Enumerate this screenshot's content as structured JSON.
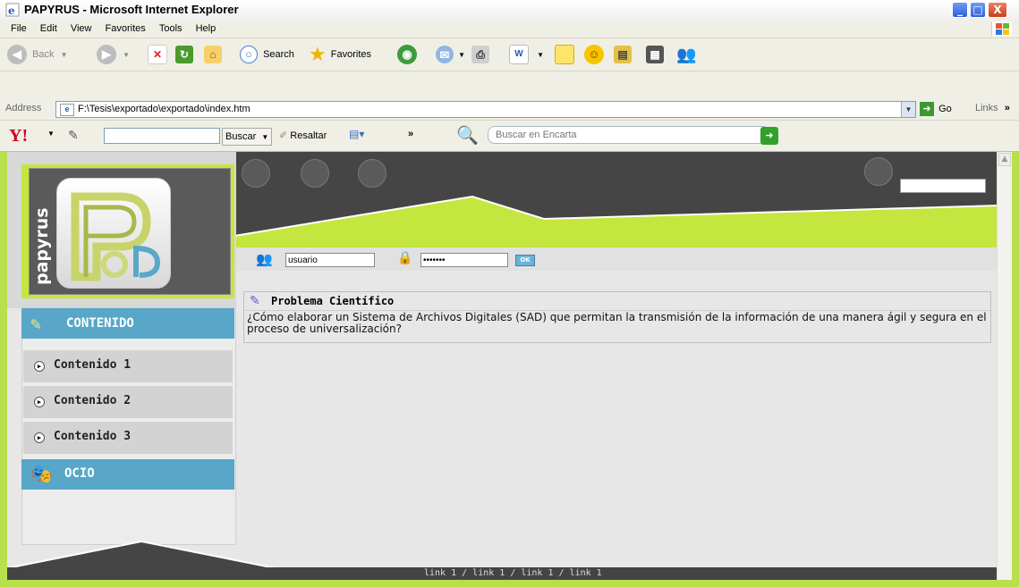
{
  "window": {
    "title": "PAPYRUS - Microsoft Internet Explorer",
    "minimize": "_",
    "maximize": "□",
    "close": "X"
  },
  "menu": [
    "File",
    "Edit",
    "View",
    "Favorites",
    "Tools",
    "Help"
  ],
  "toolbar": {
    "back_label": "Back",
    "search_label": "Search",
    "favorites_label": "Favorites"
  },
  "address": {
    "label": "Address",
    "url": "F:\\Tesis\\exportado\\exportado\\index.htm",
    "go_label": "Go",
    "links_label": "Links",
    "links_chevron": "»"
  },
  "yahoo": {
    "logo": "Y!",
    "buscar_label": "Buscar",
    "resaltar_label": "Resaltar",
    "more_chevron": "»",
    "encarta_placeholder": "Buscar en Encarta"
  },
  "site": {
    "logo_word": "papyrus",
    "login": {
      "user_value": "usuario",
      "password_value": "•••••••",
      "ok_label": "OK"
    },
    "sections": {
      "contenido_title": "CONTENIDO",
      "ocio_title": "OCIO"
    },
    "items": [
      "Contenido 1",
      "Contenido 2",
      "Contenido 3"
    ],
    "card": {
      "title": "Problema Científico",
      "body": "¿Cómo elaborar un Sistema de Archivos Digitales (SAD) que permitan la transmisión de la información de una manera ágil y segura en el proceso de universalización?"
    },
    "footer_links": "link 1 / link 1 / link 1 / link 1"
  },
  "colors": {
    "lime": "#c5e63f",
    "dark": "#454545",
    "section_blue": "#58a7c8"
  }
}
